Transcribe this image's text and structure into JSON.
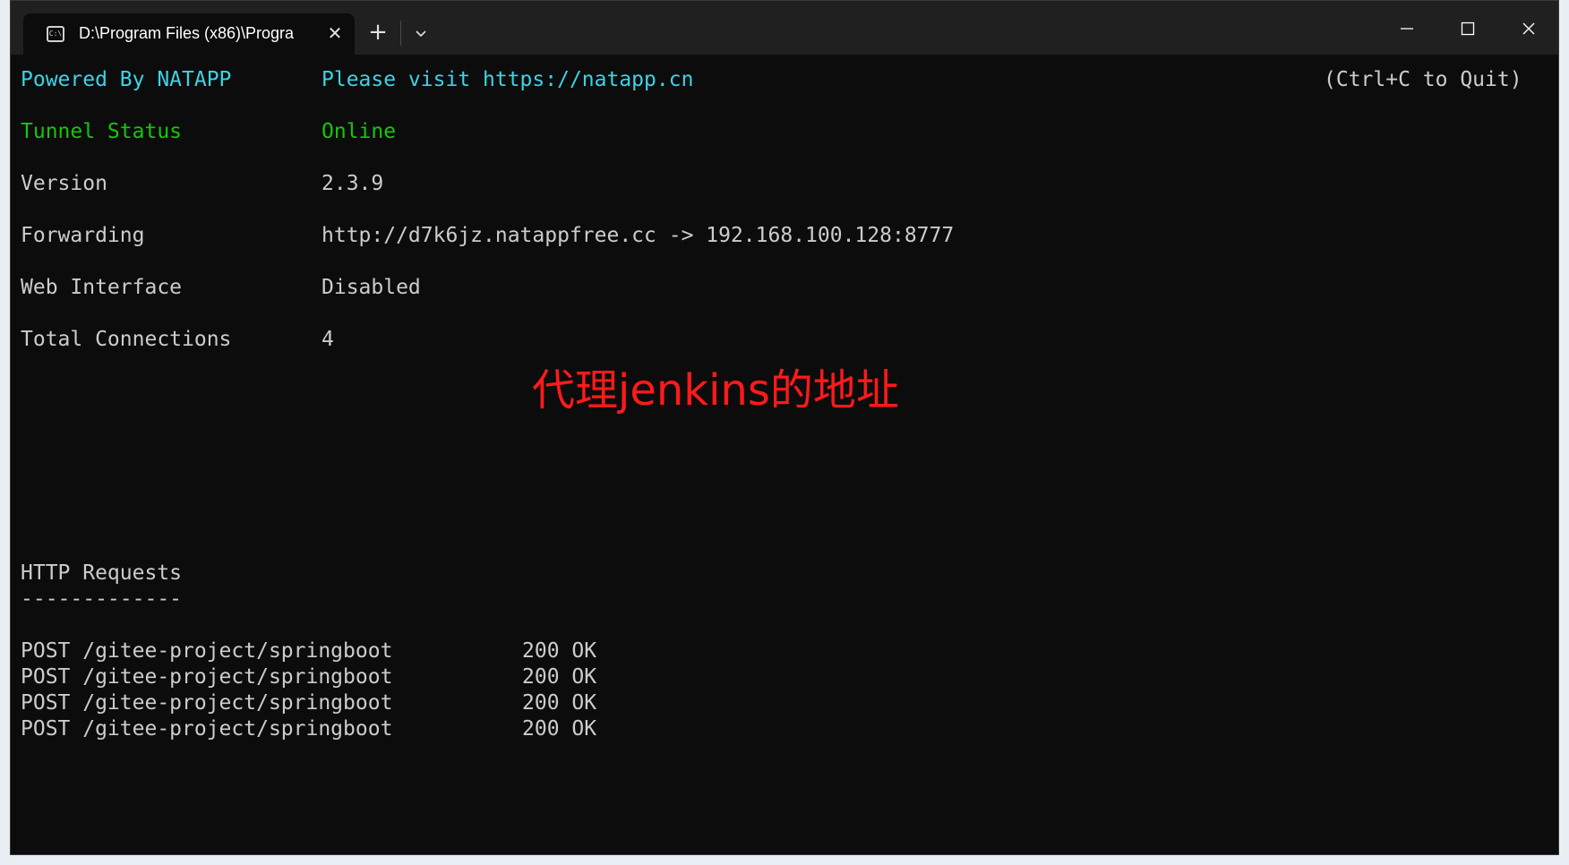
{
  "tab": {
    "icon_text": "C:\\",
    "title": "D:\\Program Files (x86)\\Progra",
    "close_glyph": "✕"
  },
  "tabbar": {
    "new_tab_glyph": "+",
    "dropdown_glyph": "⌄"
  },
  "window_controls": {
    "minimize": "—",
    "maximize": "☐",
    "close": "✕"
  },
  "console": {
    "header": {
      "powered_by": "Powered By NATAPP",
      "visit": "Please visit https://natapp.cn",
      "quit_hint": "(Ctrl+C to Quit)"
    },
    "status": [
      {
        "label": "Tunnel Status",
        "value": "Online"
      },
      {
        "label": "Version",
        "value": "2.3.9"
      },
      {
        "label": "Forwarding",
        "value": "http://d7k6jz.natappfree.cc -> 192.168.100.128:8777"
      },
      {
        "label": "Web Interface",
        "value": "Disabled"
      },
      {
        "label": "Total Connections",
        "value": "4"
      }
    ],
    "http_requests_title": "HTTP Requests",
    "http_requests_rule": "-------------",
    "requests": [
      {
        "method_path": "POST /gitee-project/springboot",
        "status": "200 OK"
      },
      {
        "method_path": "POST /gitee-project/springboot",
        "status": "200 OK"
      },
      {
        "method_path": "POST /gitee-project/springboot",
        "status": "200 OK"
      },
      {
        "method_path": "POST /gitee-project/springboot",
        "status": "200 OK"
      }
    ]
  },
  "annotation": "代理jenkins的地址",
  "colors": {
    "background": "#0c0c0c",
    "cyan": "#3ad4e6",
    "green": "#16c60c",
    "text": "#cccccc",
    "annotation": "#ff1a1a"
  }
}
